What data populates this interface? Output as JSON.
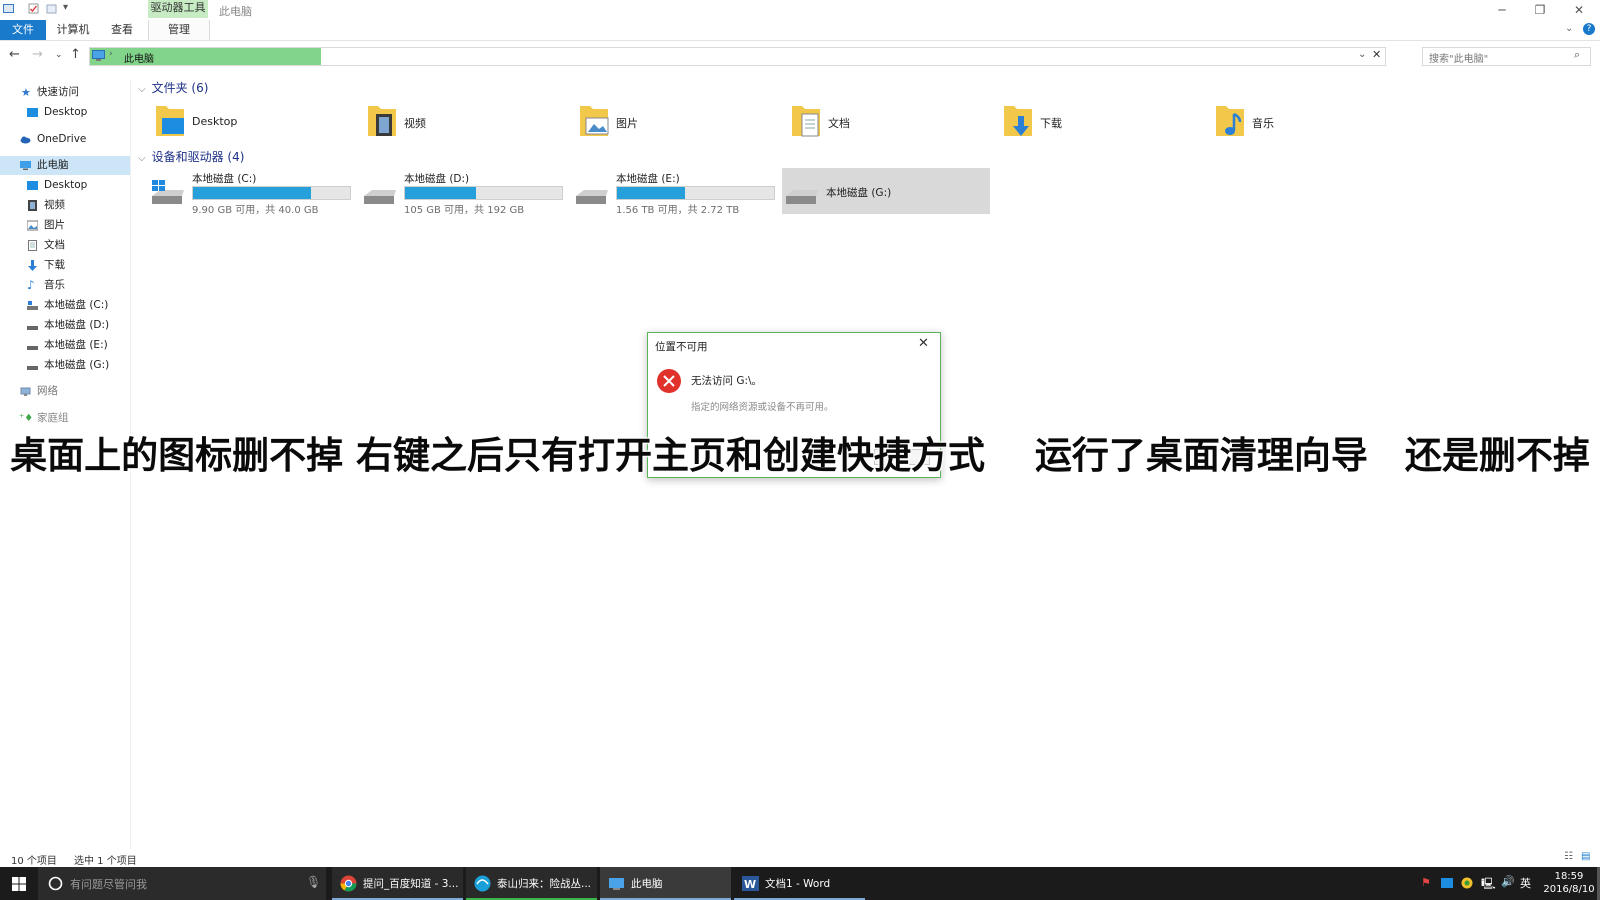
{
  "window": {
    "title": "此电脑",
    "context_tab": "驱动器工具"
  },
  "ribbon": {
    "tabs": [
      {
        "label": "文件"
      },
      {
        "label": "计算机"
      },
      {
        "label": "查看"
      },
      {
        "label": "管理"
      }
    ]
  },
  "address": {
    "path": "此电脑",
    "search_placeholder": "搜索\"此电脑\""
  },
  "navpane": {
    "items": [
      {
        "label": "快速访问",
        "icon": "star-icon"
      },
      {
        "label": "Desktop",
        "icon": "desktop-icon"
      },
      {
        "label": "OneDrive",
        "icon": "cloud-icon"
      },
      {
        "label": "此电脑",
        "icon": "computer-icon"
      },
      {
        "label": "Desktop",
        "icon": "desktop-icon"
      },
      {
        "label": "视频",
        "icon": "video-icon"
      },
      {
        "label": "图片",
        "icon": "picture-icon"
      },
      {
        "label": "文档",
        "icon": "document-icon"
      },
      {
        "label": "下载",
        "icon": "download-icon"
      },
      {
        "label": "音乐",
        "icon": "music-icon"
      },
      {
        "label": "本地磁盘 (C:)",
        "icon": "drive-icon"
      },
      {
        "label": "本地磁盘 (D:)",
        "icon": "drive-icon"
      },
      {
        "label": "本地磁盘 (E:)",
        "icon": "drive-icon"
      },
      {
        "label": "本地磁盘 (G:)",
        "icon": "drive-icon"
      },
      {
        "label": "网络",
        "icon": "network-icon"
      },
      {
        "label": "家庭组",
        "icon": "homegroup-icon"
      }
    ]
  },
  "content": {
    "folders_header": "文件夹 (6)",
    "folders": [
      {
        "label": "Desktop",
        "icon": "desktop-folder-icon"
      },
      {
        "label": "视频",
        "icon": "video-folder-icon"
      },
      {
        "label": "图片",
        "icon": "picture-folder-icon"
      },
      {
        "label": "文档",
        "icon": "document-folder-icon"
      },
      {
        "label": "下载",
        "icon": "download-folder-icon"
      },
      {
        "label": "音乐",
        "icon": "music-folder-icon"
      }
    ],
    "drives_header": "设备和驱动器 (4)",
    "drives": [
      {
        "name": "本地磁盘 (C:)",
        "size": "9.90 GB 可用，共 40.0 GB",
        "used_fraction": 0.75
      },
      {
        "name": "本地磁盘 (D:)",
        "size": "105 GB 可用，共 192 GB",
        "used_fraction": 0.45
      },
      {
        "name": "本地磁盘 (E:)",
        "size": "1.56 TB 可用，共 2.72 TB",
        "used_fraction": 0.43
      },
      {
        "name": "本地磁盘 (G:)",
        "size": "",
        "used_fraction": null
      }
    ]
  },
  "dialog": {
    "title": "位置不可用",
    "message": "无法访问 G:\\。",
    "detail": "指定的网络资源或设备不再可用。"
  },
  "caption": "桌面上的图标删不掉 右键之后只有打开主页和创建快捷方式　 运行了桌面清理向导　还是删不掉",
  "statusbar": {
    "count": "10 个项目",
    "selected": "选中 1 个项目"
  },
  "taskbar": {
    "search_placeholder": "有问题尽管问我",
    "apps": [
      {
        "label": "提问_百度知道 - 3...",
        "icon": "chrome-icon"
      },
      {
        "label": "泰山归来：险战丛...",
        "icon": "browser-icon"
      },
      {
        "label": "此电脑",
        "icon": "explorer-icon"
      },
      {
        "label": "文档1 - Word",
        "icon": "word-icon"
      }
    ],
    "tray": {
      "ime": "英",
      "time": "18:59",
      "date": "2016/8/10"
    }
  },
  "colors": {
    "accent": "#1979ca",
    "drive_bar": "#26a0da",
    "selection": "#cde6f7",
    "error": "#e0322b",
    "address_progress": "#82d48a"
  }
}
